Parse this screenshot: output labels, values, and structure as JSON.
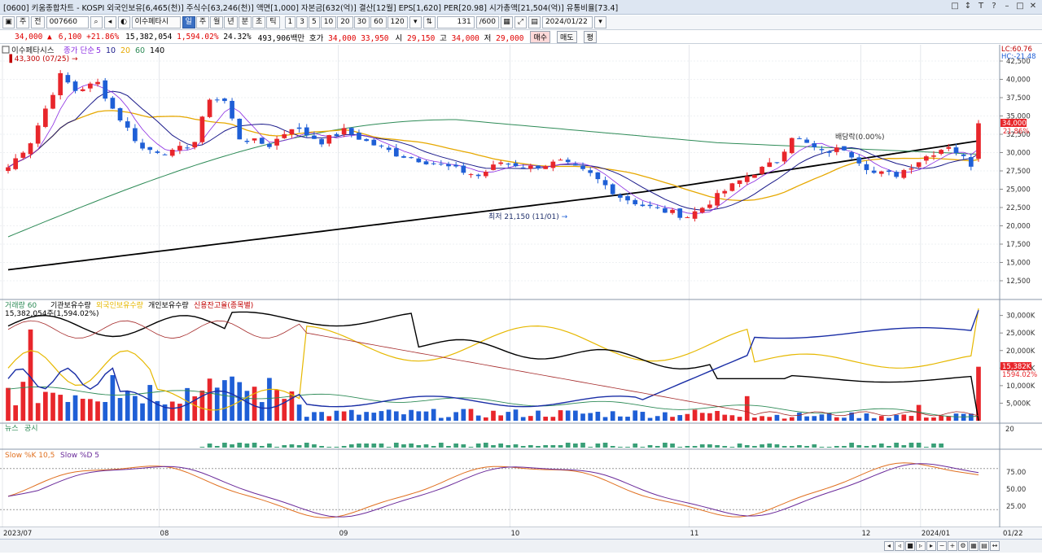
{
  "title": {
    "text": "[0600] 키움종합차트 - KOSPI 외국인보유[6,465(천)] 주식수[63,246(천)] 액면[1,000] 자본금[632(억)] 결산[12월] EPS[1,620] PER[20.98] 시가총액[21,504(억)] 유통비율[73.4]",
    "window_buttons": [
      "□",
      "↕",
      "T",
      "?",
      "–",
      "□",
      "✕"
    ]
  },
  "toolbar": {
    "market_label": "주",
    "filter_label": "전",
    "code_value": "007660",
    "stock_name": "이수페타시",
    "period_buttons": [
      {
        "label": "일",
        "selected": true
      },
      {
        "label": "주",
        "selected": false
      },
      {
        "label": "월",
        "selected": false
      },
      {
        "label": "년",
        "selected": false
      },
      {
        "label": "분",
        "selected": false
      },
      {
        "label": "초",
        "selected": false
      },
      {
        "label": "틱",
        "selected": false
      }
    ],
    "interval_buttons": [
      "1",
      "3",
      "5",
      "10",
      "20",
      "30",
      "60",
      "120"
    ],
    "count_value": "131",
    "count_total": "/600",
    "date_value": "2024/01/22"
  },
  "quote": {
    "price": "34,000",
    "change": "6,100",
    "change_pct": "+21.86%",
    "volume": "15,382,054",
    "volume_pct": "1,594.02%",
    "turnover_pct": "24.32%",
    "amount": "493,906백만",
    "bid_label": "호가",
    "bid_value": "34,000",
    "ask_value": "33,950",
    "open_label": "시",
    "open_value": "29,150",
    "high_label": "고",
    "high_value": "34,000",
    "low_label": "저",
    "low_value": "29,000",
    "buy_label": "매수",
    "sell_label": "매도",
    "flat_label": "평"
  },
  "price_panel": {
    "stock": "이수페타시스",
    "ma_title": "종가 단순",
    "ma_periods": [
      "5",
      "10",
      "20",
      "60",
      "140"
    ],
    "ma_colors": [
      "#8a2be2",
      "#1a1a8a",
      "#e6a800",
      "#2e8b57",
      "#000000"
    ],
    "high_note": "43,300 (07/25)",
    "low_note": "최저 21,150 (11/01)",
    "dividend_note": "배당락(0.00%)",
    "lc_label": "LC:60.76",
    "hc_label": "HC:-21.48",
    "price_tag": "34,000",
    "pct_tag": "21.86%",
    "axis_ticks": [
      "42,500",
      "40,000",
      "37,500",
      "35,000",
      "32,500",
      "30,000",
      "27,500",
      "25,000",
      "22,500",
      "20,000",
      "17,500",
      "15,000",
      "12,500"
    ]
  },
  "volume_panel": {
    "legend": [
      {
        "text": "거래량 60",
        "color": "#2e8b57"
      },
      {
        "text": "기관보유수량",
        "color": "#000000"
      },
      {
        "text": "외국인보유수량",
        "color": "#e6b800"
      },
      {
        "text": "개인보유수량",
        "color": "#000000"
      },
      {
        "text": "신용잔고율(종목별)",
        "color": "#c00000"
      }
    ],
    "summary": "15,382,054주(1,594.02%)",
    "volume_tag": "15,382K",
    "pct_tag": "1594.02%",
    "axis_ticks": [
      "30,000K",
      "25,000K",
      "20,000K",
      "15,000K",
      "10,000K",
      "5,000K"
    ]
  },
  "news_panel": {
    "legend": [
      "뉴스",
      "공시"
    ],
    "axis_tick": "20"
  },
  "stoch_panel": {
    "legend": [
      "Slow %K 10,5",
      "Slow %D 5"
    ],
    "axis_ticks": [
      "75.00",
      "50.00",
      "25.00"
    ]
  },
  "x_axis": [
    "2023/07",
    "08",
    "09",
    "10",
    "11",
    "12",
    "2024/01",
    "01/22"
  ],
  "colors": {
    "up": "#e8262b",
    "down": "#1f5fd6",
    "ma140": "#000000",
    "ma60": "#2e8b57",
    "ma20": "#e6a800"
  }
}
